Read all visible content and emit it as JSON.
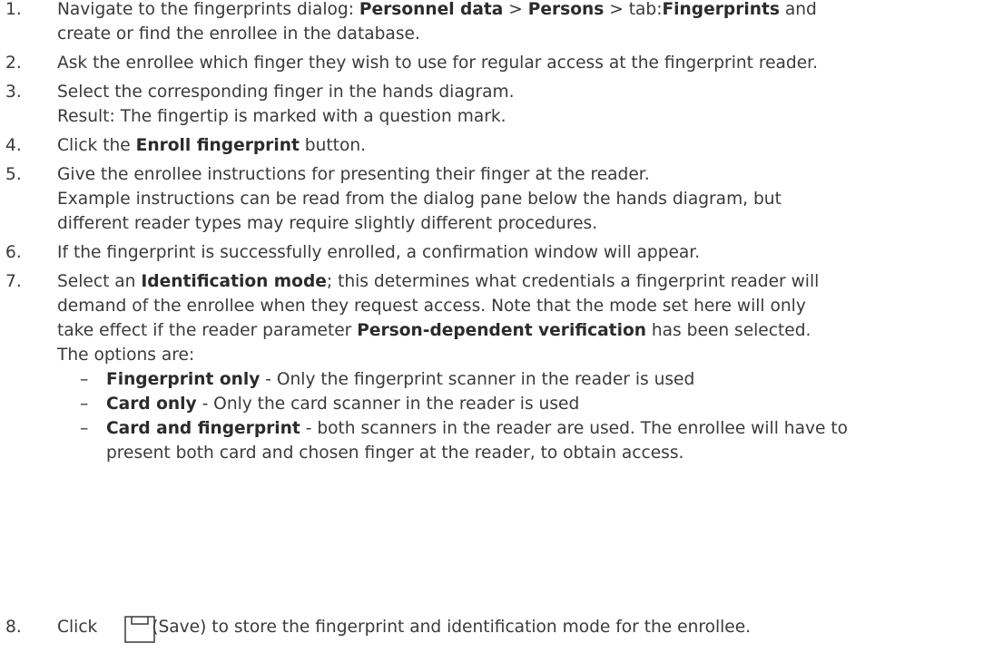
{
  "steps": [
    {
      "num": "1.",
      "lines": [
        [
          {
            "t": "Navigate to the fingerprints dialog: "
          },
          {
            "t": "Personnel data",
            "b": 1
          },
          {
            "t": " > "
          },
          {
            "t": "Persons",
            "b": 1
          },
          {
            "t": " > tab:"
          },
          {
            "t": "Fingerprints",
            "b": 1
          },
          {
            "t": " and"
          }
        ],
        [
          {
            "t": "create or find the enrollee in the database."
          }
        ]
      ]
    },
    {
      "num": "2.",
      "lines": [
        [
          {
            "t": "Ask the enrollee which finger they wish to use for regular access at the fingerprint reader."
          }
        ]
      ]
    },
    {
      "num": "3.",
      "lines": [
        [
          {
            "t": "Select the corresponding finger in the hands diagram."
          }
        ],
        [
          {
            "t": "Result: The fingertip is marked with a question mark."
          }
        ]
      ]
    },
    {
      "num": "4.",
      "lines": [
        [
          {
            "t": "Click the "
          },
          {
            "t": "Enroll fingerprint",
            "b": 1
          },
          {
            "t": " button."
          }
        ]
      ]
    },
    {
      "num": "5.",
      "lines": [
        [
          {
            "t": "Give the enrollee instructions for presenting their finger at the reader."
          }
        ],
        [
          {
            "t": "Example instructions can be read from the dialog pane below the hands diagram, but"
          }
        ],
        [
          {
            "t": "different reader types may require slightly different procedures."
          }
        ]
      ]
    },
    {
      "num": "6.",
      "lines": [
        [
          {
            "t": "If the fingerprint is successfully enrolled, a confirmation window will appear."
          }
        ]
      ]
    },
    {
      "num": "7.",
      "lines": [
        [
          {
            "t": "Select an "
          },
          {
            "t": "Identification mode",
            "b": 1
          },
          {
            "t": "; this determines what credentials a fingerprint reader will"
          }
        ],
        [
          {
            "t": "demand of the enrollee when they request access. Note that the mode set here will only"
          }
        ],
        [
          {
            "t": "take effect if the reader parameter "
          },
          {
            "t": "Person-dependent verification",
            "b": 1
          },
          {
            "t": " has been selected."
          }
        ],
        [
          {
            "t": "The options are:"
          }
        ]
      ],
      "bullets": [
        {
          "dash": "–",
          "lines": [
            [
              {
                "t": "Fingerprint only",
                "b": 1
              },
              {
                "t": " - Only the fingerprint scanner in the reader is used"
              }
            ]
          ]
        },
        {
          "dash": "–",
          "lines": [
            [
              {
                "t": "Card only",
                "b": 1
              },
              {
                "t": " - Only the card scanner in the reader is used"
              }
            ]
          ]
        },
        {
          "dash": "–",
          "lines": [
            [
              {
                "t": "Card and fingerprint",
                "b": 1
              },
              {
                "t": " - both scanners in the reader are used. The enrollee will have to"
              }
            ],
            [
              {
                "t": "present both card and chosen finger at the reader, to obtain access."
              }
            ]
          ]
        }
      ]
    },
    {
      "num": "8.",
      "lines": [
        [
          {
            "t": "Click "
          }
        ]
      ],
      "after_icon": "(Save) to store the fingerprint and identification mode for the enrollee.",
      "icon": "save-icon"
    }
  ]
}
